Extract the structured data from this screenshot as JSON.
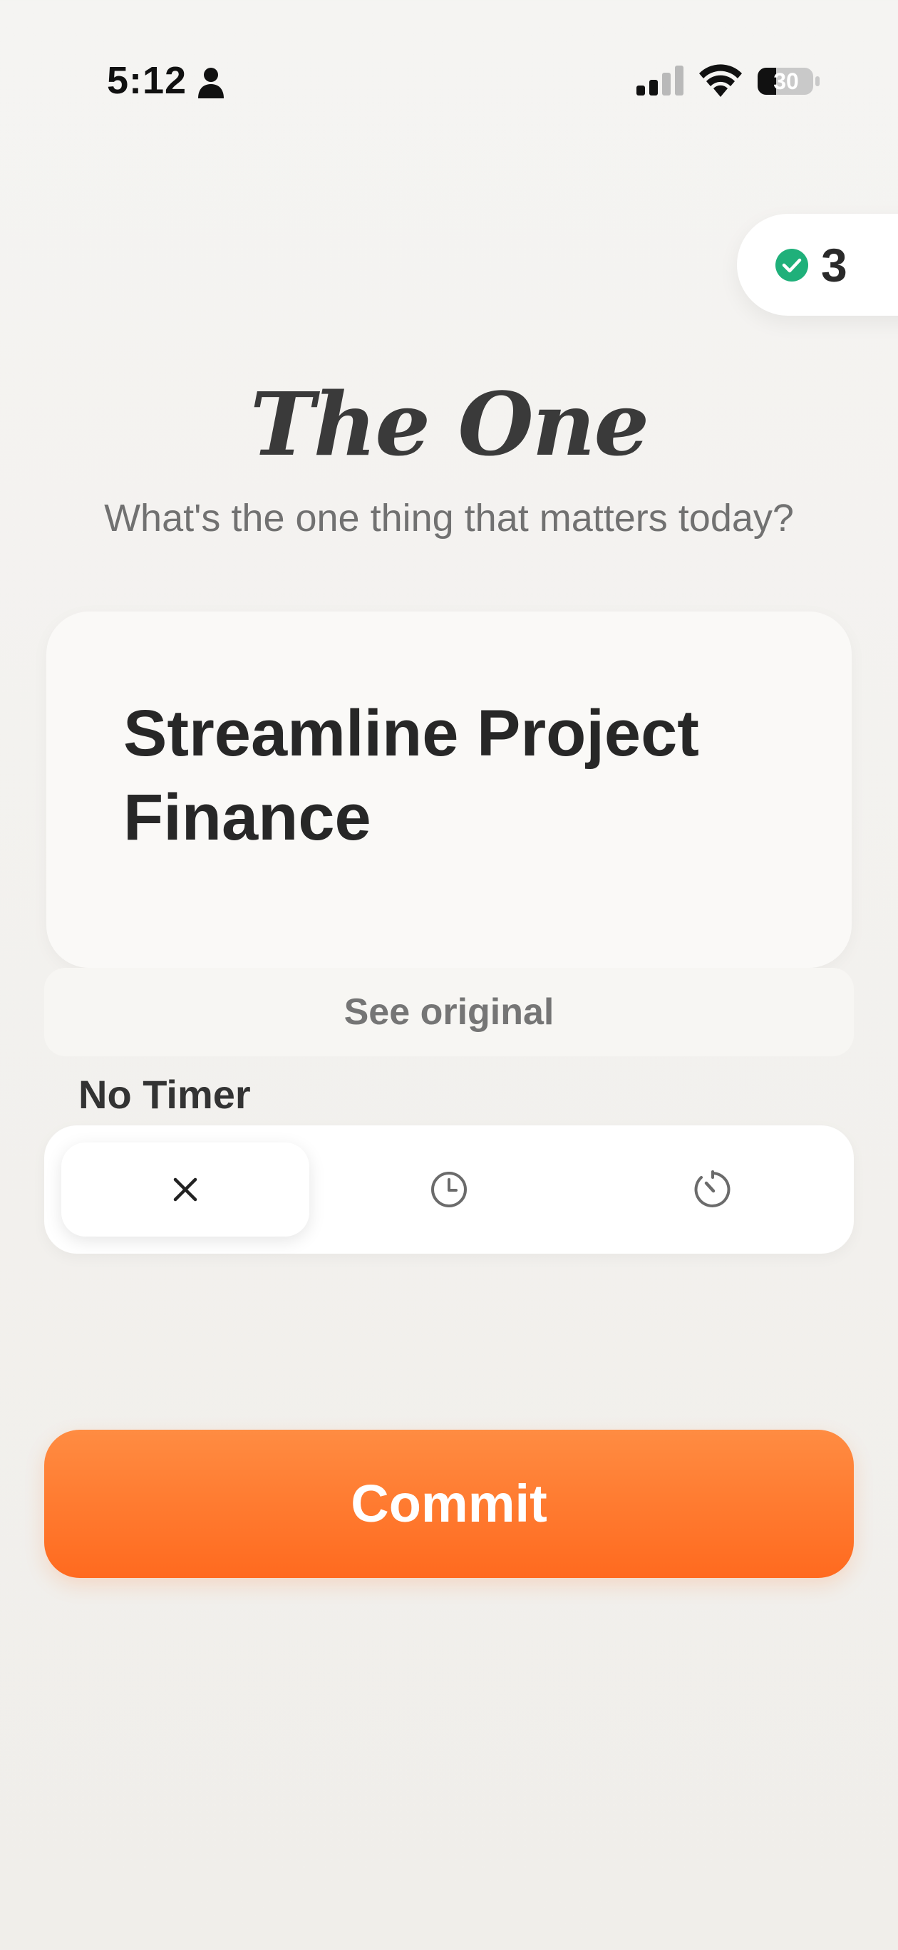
{
  "status_bar": {
    "time": "5:12",
    "battery": "30",
    "icons": [
      "person-icon",
      "cellular-signal-icon",
      "wifi-icon",
      "battery-icon"
    ]
  },
  "streak": {
    "count": "3",
    "icon": "check-circle-icon",
    "icon_color": "#1fb07a"
  },
  "header": {
    "title": "The One",
    "subtitle": "What's the one thing that matters today?"
  },
  "task": {
    "text": "Streamline Project Finance"
  },
  "see_original": {
    "label": "See original"
  },
  "timer": {
    "label": "No Timer",
    "options": [
      {
        "icon": "close-icon",
        "selected": true
      },
      {
        "icon": "clock-icon",
        "selected": false
      },
      {
        "icon": "stopwatch-icon",
        "selected": false
      }
    ]
  },
  "commit": {
    "label": "Commit",
    "color": "#ff7a2f"
  }
}
